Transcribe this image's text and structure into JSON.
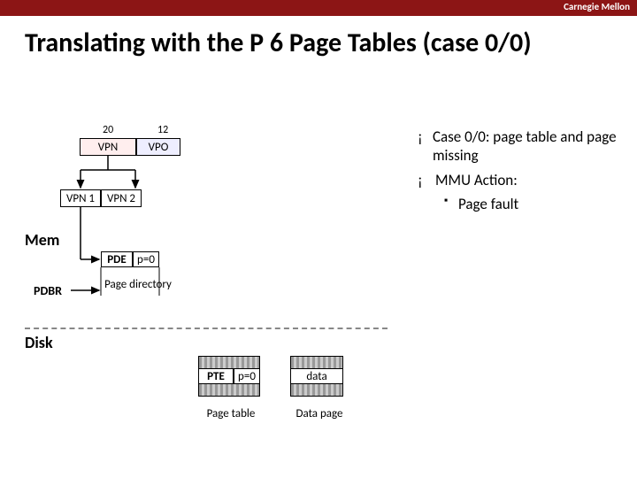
{
  "brand": "Carnegie Mellon",
  "title": "Translating with the P 6 Page Tables (case 0/0)",
  "vpn": {
    "bits": "20",
    "label": "VPN"
  },
  "vpo": {
    "bits": "12",
    "label": "VPO"
  },
  "vpn1": "VPN 1",
  "vpn2": "VPN 2",
  "mem": "Mem",
  "disk": "Disk",
  "pdbr": "PDBR",
  "pde": "PDE",
  "pde_p": "p=0",
  "pagedir": "Page directory",
  "pte": "PTE",
  "pte_p": "p=0",
  "pagetable": "Page table",
  "data": "data",
  "datapage": "Data page",
  "bullets": {
    "b1": "Case 0/0: page table and page missing",
    "b2": "MMU Action:",
    "s1": "Page fault"
  }
}
